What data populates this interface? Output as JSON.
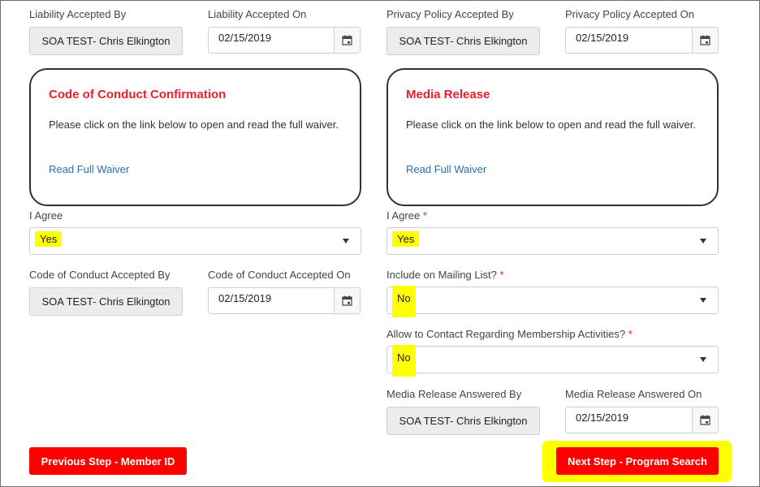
{
  "liability": {
    "accepted_by_label": "Liability Accepted By",
    "accepted_by_value": "SOA TEST- Chris Elkington",
    "accepted_on_label": "Liability Accepted On",
    "accepted_on_value": "02/15/2019"
  },
  "privacy": {
    "accepted_by_label": "Privacy Policy Accepted By",
    "accepted_by_value": "SOA TEST- Chris Elkington",
    "accepted_on_label": "Privacy Policy Accepted On",
    "accepted_on_value": "02/15/2019"
  },
  "code_of_conduct": {
    "title": "Code of Conduct Confirmation",
    "text": "Please click on the link below to open and read the full waiver.",
    "link": "Read Full Waiver",
    "agree_label": "I Agree",
    "agree_value": "Yes",
    "accepted_by_label": "Code of Conduct Accepted By",
    "accepted_by_value": "SOA TEST- Chris Elkington",
    "accepted_on_label": "Code of Conduct Accepted On",
    "accepted_on_value": "02/15/2019"
  },
  "media_release": {
    "title": "Media Release",
    "text": "Please click on the link below to open and read the full waiver.",
    "link": "Read Full Waiver",
    "agree_label": "I Agree",
    "agree_value": "Yes",
    "mailing_label": "Include on Mailing List?",
    "mailing_value": "No",
    "contact_label": "Allow to Contact Regarding Membership Activities?",
    "contact_value": "No",
    "answered_by_label": "Media Release Answered By",
    "answered_by_value": "SOA TEST- Chris Elkington",
    "answered_on_label": "Media Release Answered On",
    "answered_on_value": "02/15/2019"
  },
  "required_marker": "*",
  "buttons": {
    "previous": "Previous Step - Member ID",
    "next": "Next Step - Program Search"
  },
  "colors": {
    "accent_red": "#e8212b",
    "button_red": "#ff0000",
    "highlight": "#ffff00",
    "link_blue": "#2a6fb0"
  },
  "icons": {
    "date_picker": "calendar-icon",
    "dropdown": "chevron-down-icon"
  }
}
